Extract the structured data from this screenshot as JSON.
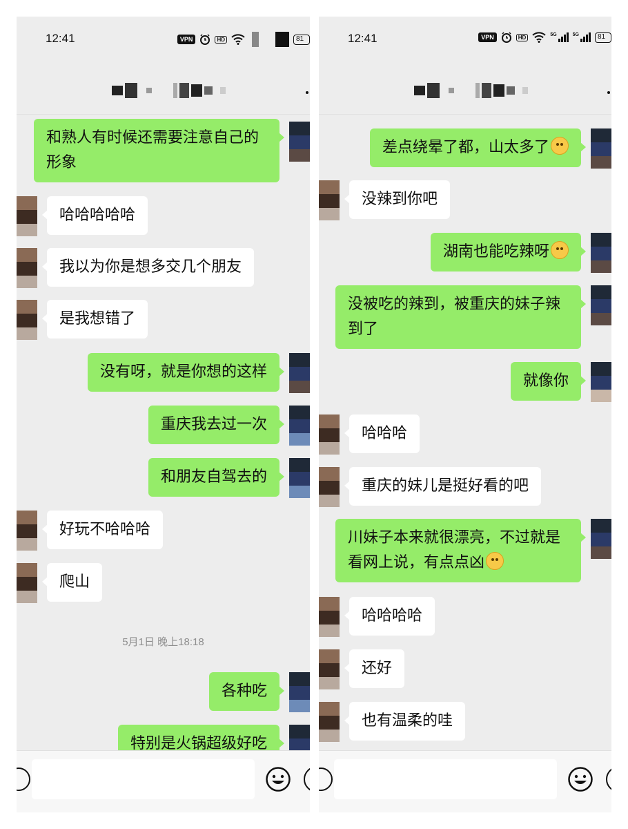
{
  "left": {
    "status": {
      "time": "12:41",
      "vpn": "VPN",
      "hd": "HD",
      "battery": "81"
    },
    "messages": [
      {
        "dir": "out",
        "text": "和熟人有时候还需要注意自己的形象"
      },
      {
        "dir": "in",
        "text": "哈哈哈哈哈"
      },
      {
        "dir": "in",
        "text": "我以为你是想多交几个朋友"
      },
      {
        "dir": "in",
        "text": "是我想错了"
      },
      {
        "dir": "out",
        "text": "没有呀，就是你想的这样"
      },
      {
        "dir": "out",
        "text": "重庆我去过一次"
      },
      {
        "dir": "out",
        "text": "和朋友自驾去的"
      },
      {
        "dir": "in",
        "text": "好玩不哈哈哈"
      },
      {
        "dir": "in",
        "text": "爬山"
      },
      {
        "dir": "out",
        "text": "各种吃"
      },
      {
        "dir": "out",
        "text": "特别是火锅超级好吃"
      }
    ],
    "timestamp": "5月1日 晚上18:18"
  },
  "right": {
    "status": {
      "time": "12:41",
      "vpn": "VPN",
      "hd": "HD",
      "battery": "81",
      "net1": "5G",
      "net2": "5G"
    },
    "messages": [
      {
        "dir": "out",
        "text": "差点绕晕了都，山太多了",
        "emoji": "laughing-crying-emoji"
      },
      {
        "dir": "in",
        "text": "没辣到你吧"
      },
      {
        "dir": "out",
        "text": "湖南也能吃辣呀",
        "emoji": "thinking-emoji"
      },
      {
        "dir": "out",
        "text": "没被吃的辣到，被重庆的妹子辣到了"
      },
      {
        "dir": "out",
        "text": "就像你"
      },
      {
        "dir": "in",
        "text": "哈哈哈"
      },
      {
        "dir": "in",
        "text": "重庆的妹儿是挺好看的吧"
      },
      {
        "dir": "out",
        "text": "川妹子本来就很漂亮，不过就是看网上说，有点点凶",
        "emoji": "flushed-emoji"
      },
      {
        "dir": "in",
        "text": "哈哈哈哈"
      },
      {
        "dir": "in",
        "text": "还好"
      },
      {
        "dir": "in",
        "text": "也有温柔的哇"
      }
    ]
  },
  "colors": {
    "outgoing_bubble": "#95ec69",
    "incoming_bubble": "#ffffff",
    "background": "#ededed"
  }
}
